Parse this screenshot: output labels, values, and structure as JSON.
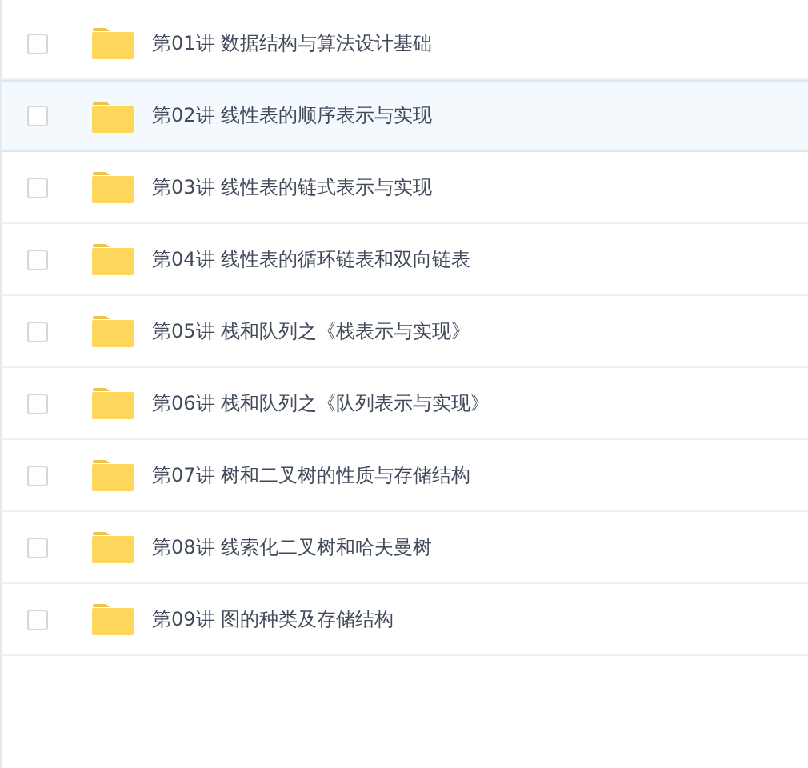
{
  "files": [
    {
      "name": "第01讲 数据结构与算法设计基础",
      "checked": false,
      "highlighted": false
    },
    {
      "name": "第02讲 线性表的顺序表示与实现",
      "checked": false,
      "highlighted": true
    },
    {
      "name": "第03讲 线性表的链式表示与实现",
      "checked": false,
      "highlighted": false
    },
    {
      "name": "第04讲 线性表的循环链表和双向链表",
      "checked": false,
      "highlighted": false
    },
    {
      "name": "第05讲 栈和队列之《栈表示与实现》",
      "checked": false,
      "highlighted": false
    },
    {
      "name": "第06讲 栈和队列之《队列表示与实现》",
      "checked": false,
      "highlighted": false
    },
    {
      "name": "第07讲 树和二叉树的性质与存储结构",
      "checked": false,
      "highlighted": false
    },
    {
      "name": "第08讲 线索化二叉树和哈夫曼树",
      "checked": false,
      "highlighted": false
    },
    {
      "name": "第09讲 图的种类及存储结构",
      "checked": false,
      "highlighted": false
    }
  ]
}
